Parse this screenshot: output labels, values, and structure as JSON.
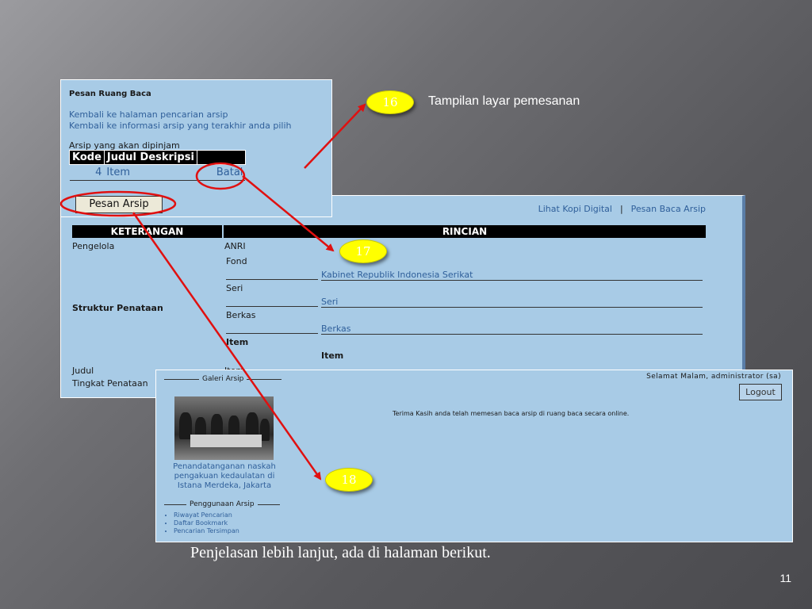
{
  "panel_pesan": {
    "title": "Pesan Ruang Baca",
    "link_back_search": "Kembali ke halaman pencarian arsip",
    "link_back_info": "Kembali ke informasi arsip yang terakhir anda pilih",
    "list_label": "Arsip yang akan dipinjam",
    "table": {
      "headers": [
        "Kode",
        "Judul Deskripsi",
        ""
      ],
      "rows": [
        {
          "kode": "4",
          "judul": "Item",
          "aksi": "Batal"
        }
      ]
    },
    "button_label": "Pesan Arsip"
  },
  "panel_rincian": {
    "top_links": [
      "Lihat Kopi Digital",
      "Pesan Baca Arsip"
    ],
    "separator": "|",
    "header_keterangan": "KETERANGAN",
    "header_rincian": "RINCIAN",
    "pengelola_label": "Pengelola",
    "pengelola_value": "ANRI",
    "struktur_label": "Struktur Penataan",
    "fond_label": "Fond",
    "fond_value": "Kabinet Republik Indonesia Serikat",
    "seri_label": "Seri",
    "seri_value": "Seri",
    "berkas_label": "Berkas",
    "berkas_value": "Berkas",
    "item_label": "Item",
    "item_value": "Item",
    "judul_label": "Judul",
    "judul_value": "Item",
    "tingkat_label": "Tingkat Penataan"
  },
  "panel_konfirmasi": {
    "galeri_title": "Galeri Arsip",
    "photo_caption": "Penandatanganan naskah pengakuan kedaulatan di Istana Merdeka, Jakarta",
    "greeting": "Selamat Malam, administrator (sa)",
    "logout_label": "Logout",
    "message": "Terima Kasih anda telah memesan baca arsip di ruang baca secara online.",
    "penggunaan_title": "Penggunaan Arsip",
    "menu": [
      "Riwayat Pencarian",
      "Daftar Bookmark",
      "Pencarian Tersimpan"
    ]
  },
  "annotations": {
    "badge_16": "16",
    "badge_17": "17",
    "badge_18": "18",
    "caption_16": "Tampilan layar pemesanan",
    "arrow_color": "#e01010",
    "badge_color": "#ffff00"
  },
  "footer_text": "Penjelasan lebih lanjut, ada di halaman berikut.",
  "page_number": "11"
}
